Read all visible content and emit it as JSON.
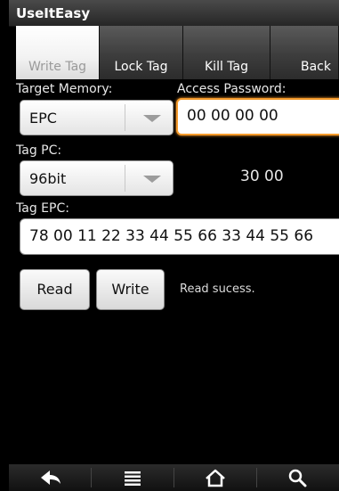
{
  "app": {
    "title": "UseItEasy"
  },
  "tabs": [
    {
      "label": "Write Tag",
      "active": true
    },
    {
      "label": "Lock Tag",
      "active": false
    },
    {
      "label": "Kill Tag",
      "active": false
    },
    {
      "label": "Back",
      "active": false
    }
  ],
  "form": {
    "target_memory_label": "Target Memory:",
    "target_memory_value": "EPC",
    "access_password_label": "Access Password:",
    "access_password_value": "00 00 00 00",
    "tag_pc_label": "Tag PC:",
    "tag_pc_value": "96bit",
    "tag_pc_hex": "30 00",
    "tag_epc_label": "Tag EPC:",
    "tag_epc_value": "78 00 11 22 33 44 55 66 33 44 55 66"
  },
  "actions": {
    "read_label": "Read",
    "write_label": "Write",
    "status": "Read sucess."
  },
  "navbar": {
    "items": [
      "back-icon",
      "menu-icon",
      "home-icon",
      "search-icon"
    ]
  },
  "colors": {
    "focus_border": "#f49a2b",
    "background": "#000000",
    "active_tab_text": "#9a9a9a"
  }
}
